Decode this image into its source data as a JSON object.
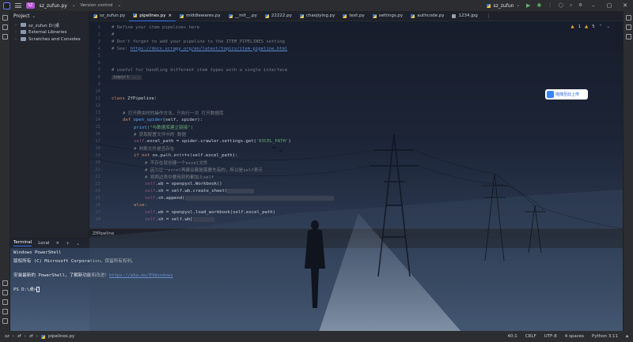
{
  "titlebar": {
    "project_badge": "SZ",
    "project_name": "sz_zufun.py",
    "vcs": "Version control",
    "run_config": "sz_zufun"
  },
  "project_panel": {
    "title": "Project",
    "items": [
      {
        "label": "sz_zufun D:\\桌"
      },
      {
        "label": "External Libraries"
      },
      {
        "label": "Scratches and Consoles"
      }
    ]
  },
  "tabs": [
    {
      "label": "sz_zufun.py",
      "active": false
    },
    {
      "label": "pipelines.py",
      "active": true
    },
    {
      "label": "middlewares.py",
      "active": false
    },
    {
      "label": "__init__.py",
      "active": false
    },
    {
      "label": "22222.py",
      "active": false
    },
    {
      "label": "chaojiying.py",
      "active": false
    },
    {
      "label": "text.py",
      "active": false
    },
    {
      "label": "settings.py",
      "active": false
    },
    {
      "label": "authcode.py",
      "active": false
    },
    {
      "label": "1234.jpg",
      "active": false
    }
  ],
  "inspections": {
    "warnings": "1",
    "ok": "5"
  },
  "code": {
    "l1": "# Define your item pipelines here",
    "l2": "#",
    "l3": "# Don't forget to add your pipeline to the ITEM_PIPELINES setting",
    "l4_prefix": "# See: ",
    "l4_link": "https://docs.scrapy.org/en/latest/topics/item-pipeline.html",
    "l7": "# useful for handling different item types with a single interface",
    "l8": "import ...",
    "l11_kw": "class ",
    "l11_name": "ZfPipeline:",
    "l13": "# 打开爬虫时的操作方法，只执行一次 打开数据库",
    "l14_kw": "def ",
    "l14_fn": "open_spider",
    "l14_rest": "(self, spider):",
    "l15_fn": "print",
    "l15_str": "(\"与数据库建立链接\")",
    "l16": "# 获取配置文件中的 数据",
    "l17_self": "self",
    "l17_rest": ".excel_path = spider.crawler.settings.get(",
    "l17_str": "'EXCEL_PATH'",
    "l17_end": ")",
    "l18": "# 判断文件是否存在",
    "l19_kw": "if not ",
    "l19_rest": "os.path.exists(self.excel_path):",
    "l20": "# 不存在就创建一个excel文件",
    "l21": "# 因为往一excel再建议都是需要先有的，所以是self表示",
    "l22": "# 将两边表中要用到的都加上self",
    "l23_self": "self",
    "l23_rest": ".wb = openpyxl.Workbook()",
    "l24_self": "self",
    "l24_rest": ".sh = self.wb.create_sheet(",
    "l25_self": "self",
    "l25_rest": ".sh.append(",
    "l26_kw": "else:",
    "l27_self": "self",
    "l27_rest": ".wb = openpyxl.load_workbook(self.excel_path)",
    "l28_self": "self",
    "l28_rest": ".sh = self.wb["
  },
  "breadcrumb": "ZfPipeline",
  "upload_widget": "拖拽至此上传",
  "terminal": {
    "tab_terminal": "Terminal",
    "tab_local": "Local",
    "line1": "Windows PowerShell",
    "line2": "版权所有 (C) Microsoft Corporation。保留所有权利。",
    "line3_prefix": "安装最新的 PowerShell，了解新功能和改进！",
    "line3_link": "https://aka.ms/PSWindows",
    "prompt": "PS D:\\桌>"
  },
  "statusbar": {
    "path_root": "sz",
    "path_1": "zf",
    "path_2": "zf",
    "file": "pipelines.py",
    "position": "40:1",
    "line_ending": "CRLF",
    "encoding": "UTF-8",
    "indent": "4 spaces",
    "interpreter": "Python 3.11"
  }
}
